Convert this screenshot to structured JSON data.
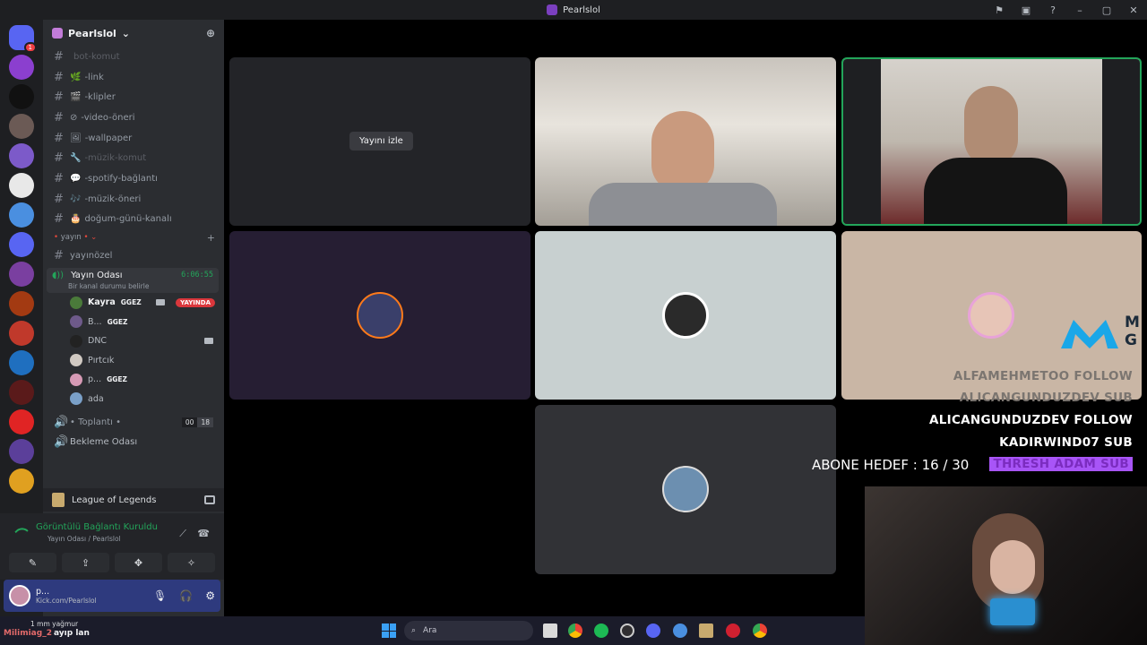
{
  "window": {
    "title": "Pearlslol",
    "controls": [
      "⚑",
      "▣",
      "?",
      "–",
      "▢",
      "✕"
    ]
  },
  "server_rail": {
    "items": [
      {
        "name": "discord-home",
        "color": "#5865f2",
        "badge": "1"
      },
      {
        "name": "server-purple",
        "color": "#8b3fcf",
        "badge": ""
      },
      {
        "name": "server-dark",
        "color": "#111111",
        "badge": ""
      },
      {
        "name": "server-photo",
        "color": "#6b5a55",
        "badge": ""
      },
      {
        "name": "server-folder",
        "color": "#7c5ac9",
        "badge": ""
      },
      {
        "name": "server-bw",
        "color": "#e8e8e8",
        "badge": ""
      },
      {
        "name": "server-blue",
        "color": "#4a8fe0",
        "badge": ""
      },
      {
        "name": "server-discord",
        "color": "#5865f2",
        "badge": ""
      },
      {
        "name": "server-anime",
        "color": "#7a3fa0",
        "badge": ""
      },
      {
        "name": "server-fire",
        "color": "#a33a12",
        "badge": ""
      },
      {
        "name": "server-red-hair",
        "color": "#c0392b",
        "badge": ""
      },
      {
        "name": "server-neon",
        "color": "#1f6fbf",
        "badge": ""
      },
      {
        "name": "server-relaxation",
        "color": "#5a1a1a",
        "badge": ""
      },
      {
        "name": "server-r",
        "color": "#e02424",
        "badge": ""
      },
      {
        "name": "server-violet",
        "color": "#5b3f9a",
        "badge": ""
      },
      {
        "name": "server-yellow",
        "color": "#e0a020",
        "badge": ""
      }
    ]
  },
  "sidebar": {
    "guild_name": "Pearlslol",
    "channels": [
      {
        "emoji": "",
        "label": "bot-komut",
        "muted": true
      },
      {
        "emoji": "🌿",
        "label": "-link",
        "muted": false
      },
      {
        "emoji": "🎬",
        "label": "-klipler",
        "muted": false
      },
      {
        "emoji": "⊘",
        "label": "-video-öneri",
        "muted": false
      },
      {
        "emoji": "🖼",
        "label": "-wallpaper",
        "muted": false
      },
      {
        "emoji": "🔧",
        "label": "-müzik-komut",
        "muted": true
      },
      {
        "emoji": "💬",
        "label": "-spotify-bağlantı",
        "muted": false
      },
      {
        "emoji": "🎶",
        "label": "-müzik-öneri",
        "muted": false
      },
      {
        "emoji": "🎂",
        "label": "doğum-günü-kanalı",
        "muted": false
      }
    ],
    "category": "yayın",
    "private_channel": "yayınözel",
    "voice": {
      "name": "Yayın Odası",
      "time": "6:06:55",
      "status": "Bir kanal durumu belirle",
      "users": [
        {
          "name": "Kayra",
          "tag": "GGEZ",
          "cam": true,
          "live": "YAYINDA",
          "color": "#4a7a3a"
        },
        {
          "name": "B...",
          "tag": "GGEZ",
          "cam": false,
          "live": "",
          "color": "#6e5a8a"
        },
        {
          "name": "DNC",
          "tag": "",
          "cam": true,
          "live": "",
          "color": "#222222"
        },
        {
          "name": "Pırtcık",
          "tag": "",
          "cam": false,
          "live": "",
          "color": "#d0c9c2"
        },
        {
          "name": "p...",
          "tag": "GGEZ",
          "cam": false,
          "live": "",
          "color": "#d69ab5"
        },
        {
          "name": "ada",
          "tag": "",
          "cam": false,
          "live": "",
          "color": "#7aa0c8"
        }
      ]
    },
    "meeting": {
      "label": "• Toplantı •",
      "count_a": "00",
      "count_b": "18"
    },
    "waiting": {
      "label": "Bekleme Odası"
    }
  },
  "activity": {
    "game": "League of Legends"
  },
  "voice_panel": {
    "connected": "Görüntülü Bağlantı Kuruldu",
    "channel": "Yayın Odası",
    "server": "/ Pearlslol",
    "buttons": [
      "✎",
      "⇪",
      "✥",
      "✧"
    ]
  },
  "user": {
    "name": "p...",
    "status": "Kick.com/Pearlslol"
  },
  "stage": {
    "watch_button": "Yayını izle"
  },
  "overlay": {
    "feed": [
      {
        "text": "ALFAMEHMETOO  FOLLOW",
        "style": "grey"
      },
      {
        "text": "ALICANGUNDUZDEV  SUB",
        "style": "grey"
      },
      {
        "text": "ALICANGUNDUZDEV  FOLLOW",
        "style": "white"
      },
      {
        "text": "KADIRWIND07  SUB",
        "style": "white"
      },
      {
        "text": "THRESH  ADAM  SUB",
        "style": "purple"
      }
    ],
    "sub_goal": "ABONE HEDEF : 16 / 30",
    "logo_text": "M\nG"
  },
  "taskbar": {
    "weather_line1": "1 mm yağmur",
    "weather_user": "Milimiag_2",
    "weather_line2": "ayıp lan",
    "search_placeholder": "Ara"
  }
}
